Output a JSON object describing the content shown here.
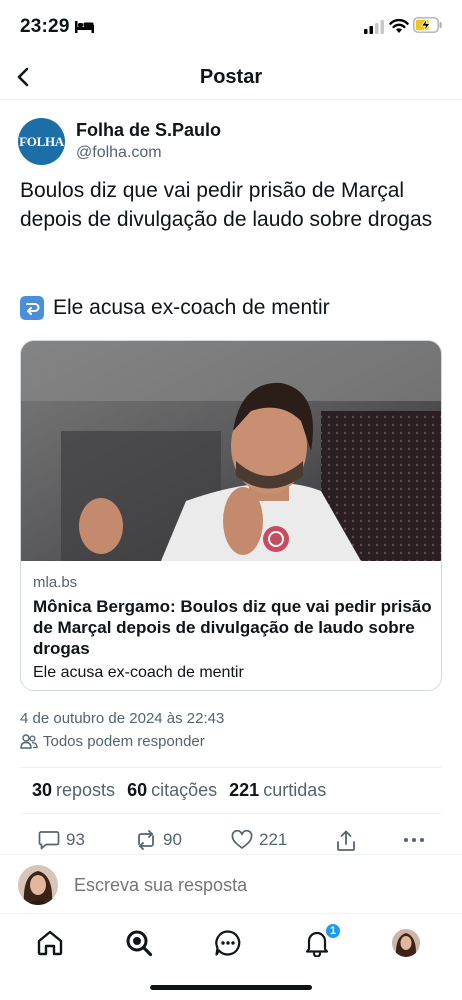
{
  "status_bar": {
    "time": "23:29"
  },
  "nav": {
    "title": "Postar"
  },
  "author": {
    "avatar_text": "FOLHA",
    "name": "Folha de S.Paulo",
    "handle": "@folha.com"
  },
  "post": {
    "text": "Boulos diz que vai pedir prisão de Marçal depois de divulgação de laudo sobre drogas",
    "text_2": "Ele acusa ex-coach de mentir"
  },
  "card": {
    "domain": "mla.bs",
    "title": "Mônica Bergamo: Boulos diz que vai pedir prisão de Marçal depois de divulgação de laudo sobre drogas",
    "description": "Ele acusa ex-coach de mentir"
  },
  "meta": {
    "date": "4 de outubro de 2024 às 22:43",
    "reply_permission": "Todos podem responder"
  },
  "stats": [
    {
      "num": "30",
      "label": "reposts"
    },
    {
      "num": "60",
      "label": "citações"
    },
    {
      "num": "221",
      "label": "curtidas"
    }
  ],
  "actions": {
    "replies": "93",
    "reposts": "90",
    "likes": "221"
  },
  "reply_bar": {
    "placeholder": "Escreva sua resposta"
  },
  "tabs": {
    "notifications_badge": "1"
  },
  "colors": {
    "accent": "#1d9bf0",
    "secondary_text": "#536471",
    "folha_blue": "#1b6fa6"
  }
}
